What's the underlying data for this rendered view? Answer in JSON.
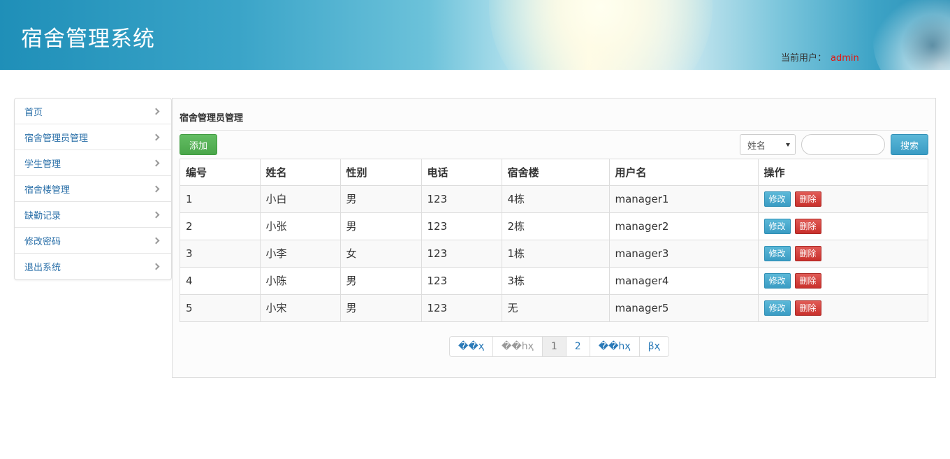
{
  "header": {
    "app_title": "宿舍管理系统",
    "current_user_label": "当前用户：",
    "current_user_name": "admin",
    "user_name_color": "#e4160e"
  },
  "sidebar": {
    "items": [
      {
        "label": "首页"
      },
      {
        "label": "宿舍管理员管理"
      },
      {
        "label": "学生管理"
      },
      {
        "label": "宿舍楼管理"
      },
      {
        "label": "缺勤记录"
      },
      {
        "label": "修改密码"
      },
      {
        "label": "退出系统"
      }
    ]
  },
  "main": {
    "panel_title": "宿舍管理员管理",
    "add_button": "添加",
    "search": {
      "field_selected": "姓名",
      "input_value": "",
      "button_label": "搜索"
    },
    "table": {
      "headers": [
        "编号",
        "姓名",
        "性别",
        "电话",
        "宿舍楼",
        "用户名",
        "操作"
      ],
      "rows": [
        {
          "id": "1",
          "name": "小白",
          "gender": "男",
          "phone": "123",
          "building": "4栋",
          "username": "manager1"
        },
        {
          "id": "2",
          "name": "小张",
          "gender": "男",
          "phone": "123",
          "building": "2栋",
          "username": "manager2"
        },
        {
          "id": "3",
          "name": "小李",
          "gender": "女",
          "phone": "123",
          "building": "1栋",
          "username": "manager3"
        },
        {
          "id": "4",
          "name": "小陈",
          "gender": "男",
          "phone": "123",
          "building": "3栋",
          "username": "manager4"
        },
        {
          "id": "5",
          "name": "小宋",
          "gender": "男",
          "phone": "123",
          "building": "无",
          "username": "manager5"
        }
      ],
      "edit_label": "修改",
      "delete_label": "删除"
    },
    "pagination": {
      "first": "��ҳ",
      "prev": "��һҳ",
      "pages": [
        "1",
        "2"
      ],
      "current_page": "1",
      "next": "��һҳ",
      "last": "βҳ"
    }
  },
  "colors": {
    "add_button": "#5cb85c",
    "info_button": "#46a8cf",
    "danger_button": "#d9534f",
    "link": "#2a7ab8"
  }
}
